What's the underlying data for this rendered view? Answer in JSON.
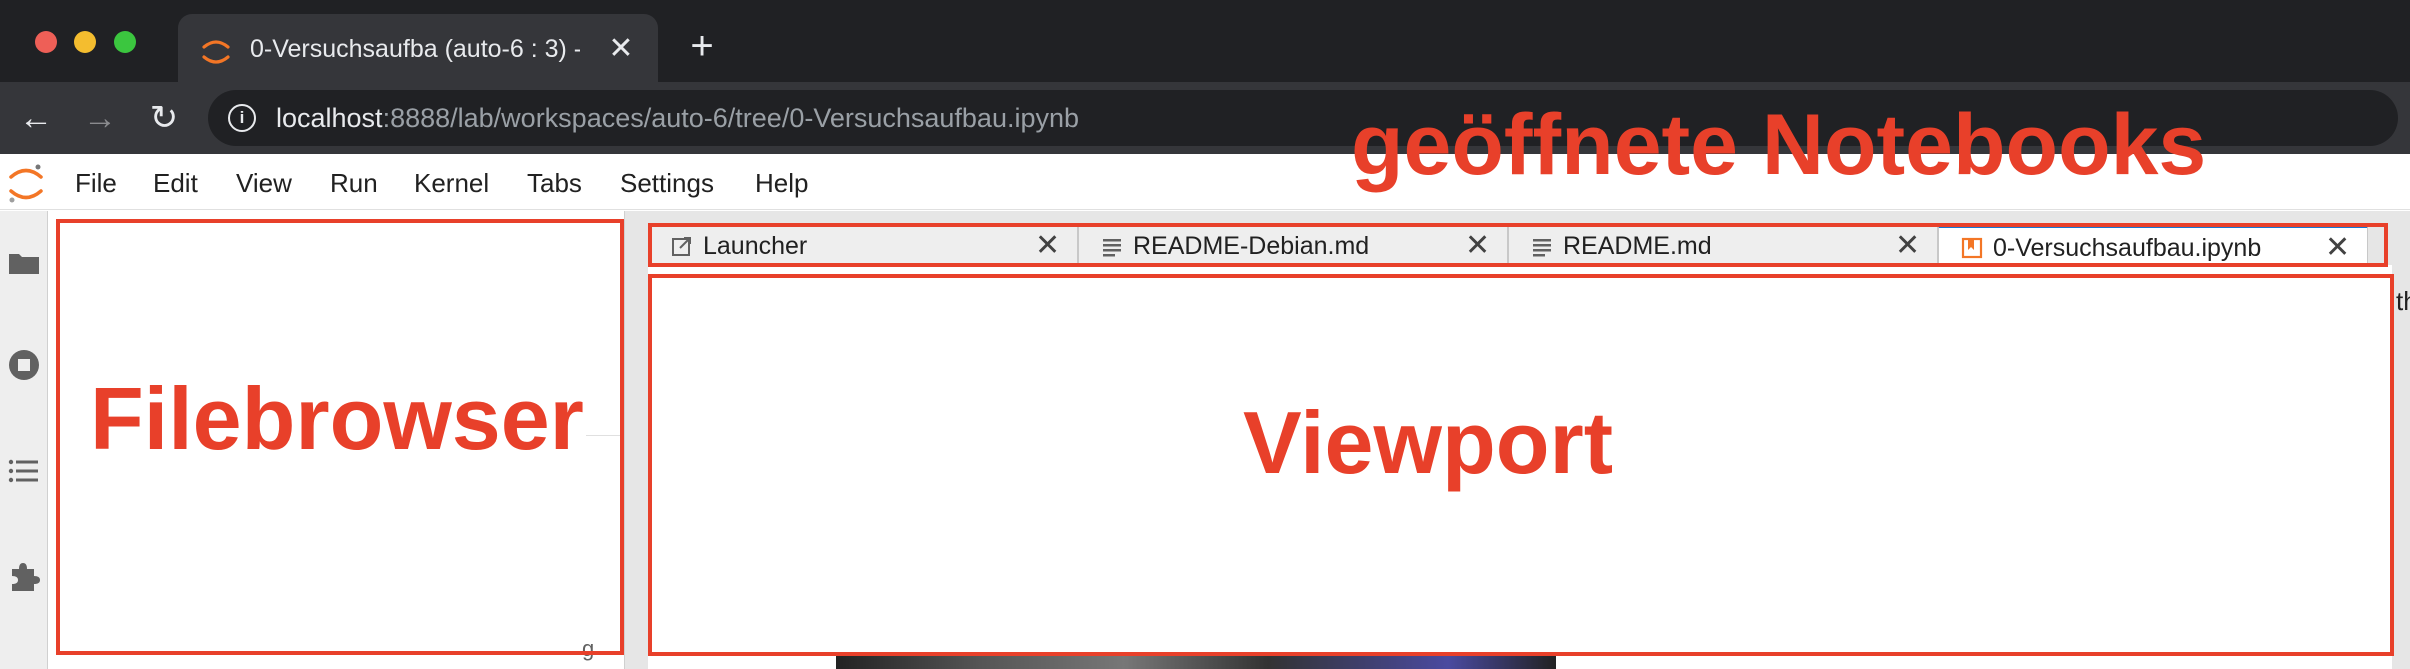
{
  "browser": {
    "tab_title": "0-Versuchsaufba (auto-6 : 3) -",
    "tab_close": "✕",
    "new_tab": "+",
    "back": "←",
    "forward": "→",
    "reload": "↻",
    "info": "i",
    "url_host": "localhost",
    "url_rest": ":8888/lab/workspaces/auto-6/tree/0-Versuchsaufbau.ipynb"
  },
  "jupyter": {
    "menu": [
      "File",
      "Edit",
      "View",
      "Run",
      "Kernel",
      "Tabs",
      "Settings",
      "Help"
    ],
    "tabs": [
      {
        "label": "Launcher",
        "icon": "launcher-icon"
      },
      {
        "label": "README-Debian.md",
        "icon": "markdown-icon"
      },
      {
        "label": "README.md",
        "icon": "markdown-icon"
      },
      {
        "label": "0-Versuchsaufbau.ipynb",
        "icon": "notebook-icon"
      }
    ],
    "tab_close": "✕",
    "sidebar_icons": [
      "folder-icon",
      "running-icon",
      "toc-icon",
      "extension-icon"
    ],
    "filebrowser_stub": "g",
    "viewport_edge": "th"
  },
  "annotations": {
    "filebrowser": "Filebrowser",
    "viewport": "Viewport",
    "tabs": "geöffnete Notebooks"
  },
  "colors": {
    "annotation": "#e8402a",
    "jupyter_orange": "#f37626",
    "chrome_dark": "#202124",
    "chrome_mid": "#35363a"
  }
}
